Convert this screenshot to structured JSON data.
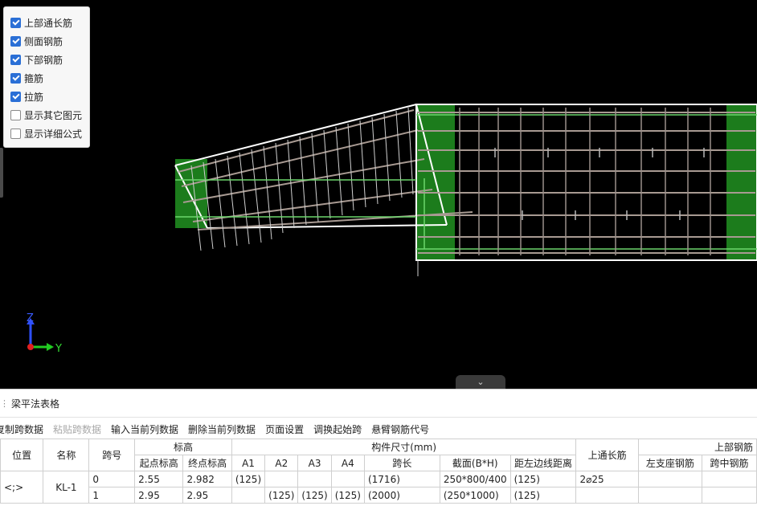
{
  "legend": {
    "items": [
      {
        "label": "上部通长筋",
        "checked": true
      },
      {
        "label": "侧面钢筋",
        "checked": true
      },
      {
        "label": "下部钢筋",
        "checked": true
      },
      {
        "label": "箍筋",
        "checked": true
      },
      {
        "label": "拉筋",
        "checked": true
      },
      {
        "label": "显示其它图元",
        "checked": false
      },
      {
        "label": "显示详细公式",
        "checked": false
      }
    ]
  },
  "axis": {
    "z_label": "Z",
    "y_label": "Y"
  },
  "collapse_icon": "chevron-down-icon",
  "colors": {
    "accent": "#2a6fd6",
    "support_green": "#1f8a1f",
    "rebar": "#a89a92",
    "outline": "#ffffff"
  },
  "panel": {
    "title": "梁平法表格",
    "toolbar": [
      "复制跨数据",
      "粘贴跨数据",
      "输入当前列数据",
      "删除当前列数据",
      "页面设置",
      "调换起始跨",
      "悬臂钢筋代号"
    ],
    "toolbar_disabled": [
      false,
      true,
      false,
      false,
      false,
      false,
      false
    ]
  },
  "table": {
    "headers": {
      "position": "位置",
      "name": "名称",
      "span": "跨号",
      "elevation": "标高",
      "start_elev": "起点标高",
      "end_elev": "终点标高",
      "dims": "构件尺寸(mm)",
      "a1": "A1",
      "a2": "A2",
      "a3": "A3",
      "a4": "A4",
      "span_len": "跨长",
      "section": "截面(B*H)",
      "edge_dist": "距左边线距离",
      "top_through": "上通长筋",
      "top_rebar": "上部钢筋",
      "left_support": "左支座钢筋",
      "mid_span": "跨中钢筋"
    },
    "position": "<;>",
    "name": "KL-1",
    "rows": [
      {
        "span": "0",
        "start": "2.55",
        "end": "2.982",
        "a1": "(125)",
        "a2": "",
        "a3": "",
        "a4": "",
        "len": "(1716)",
        "section": "250*800/400",
        "dist": "(125)",
        "top": "2⌀25",
        "left": "",
        "mid": ""
      },
      {
        "span": "1",
        "start": "2.95",
        "end": "2.95",
        "a1": "",
        "a2": "(125)",
        "a3": "(125)",
        "a4": "(125)",
        "len": "(2000)",
        "section": "(250*1000)",
        "dist": "(125)",
        "top": "",
        "left": "",
        "mid": ""
      }
    ]
  }
}
